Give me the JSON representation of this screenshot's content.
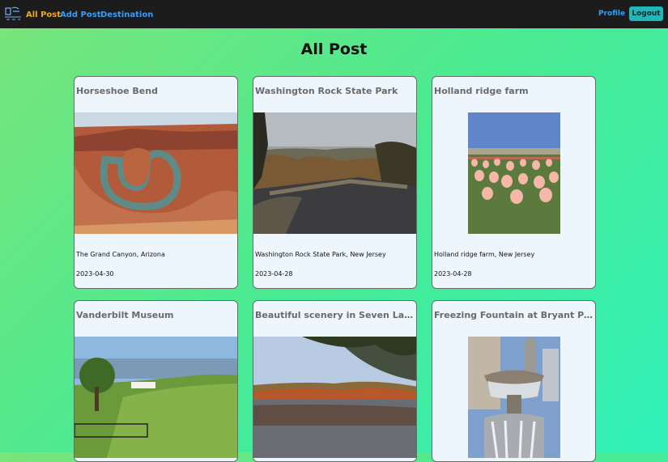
{
  "nav": {
    "links": [
      "All Post",
      "Add Post",
      "Destination"
    ],
    "profile": "Profile",
    "logout": "Logout"
  },
  "page": {
    "title": "All Post"
  },
  "posts": [
    {
      "title": "Horseshoe Bend",
      "location": "The Grand Canyon, Arizona",
      "date": "2023-04-30"
    },
    {
      "title": "Washington Rock State Park",
      "location": "Washington Rock State Park, New Jersey",
      "date": "2023-04-28"
    },
    {
      "title": "Holland ridge farm",
      "location": "Holland ridge farm, New Jersey",
      "date": "2023-04-28"
    },
    {
      "title": "Vanderbilt Museum",
      "location": "",
      "date": ""
    },
    {
      "title": "Beautiful scenery in Seven Lak...",
      "location": "",
      "date": ""
    },
    {
      "title": "Freezing Fountain at Bryant Pa...",
      "location": "",
      "date": ""
    }
  ]
}
